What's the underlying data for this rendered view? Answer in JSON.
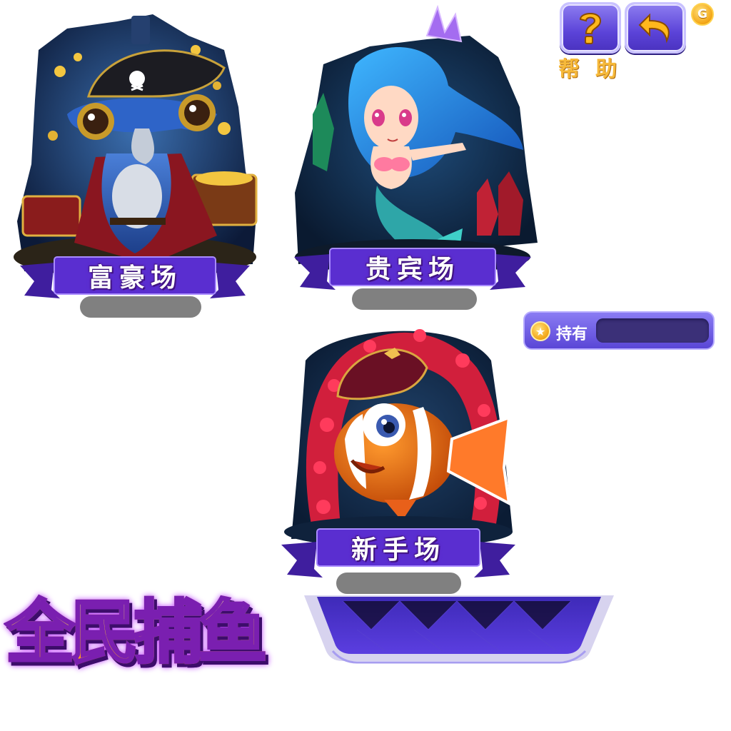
{
  "rooms": [
    {
      "id": "rich",
      "label": "富豪场",
      "character": "hammerhead-pirate"
    },
    {
      "id": "vip",
      "label": "贵宾场",
      "character": "mermaid"
    },
    {
      "id": "newbie",
      "label": "新手场",
      "character": "clownfish-pirate"
    }
  ],
  "toolbar": {
    "help_icon": "question-icon",
    "back_icon": "back-arrow-icon",
    "help_label": "帮助",
    "coin_badge": "G"
  },
  "holdings": {
    "label": "持有",
    "value": "",
    "coin_icon": "coin-star-icon"
  },
  "logo": {
    "text": "全民捕鱼"
  },
  "colors": {
    "ribbon": "#5a2ed0",
    "button": "#6b56e0",
    "pill": "#808080",
    "logo_fill": "#ffc928",
    "logo_stroke": "#7a1fb0"
  }
}
